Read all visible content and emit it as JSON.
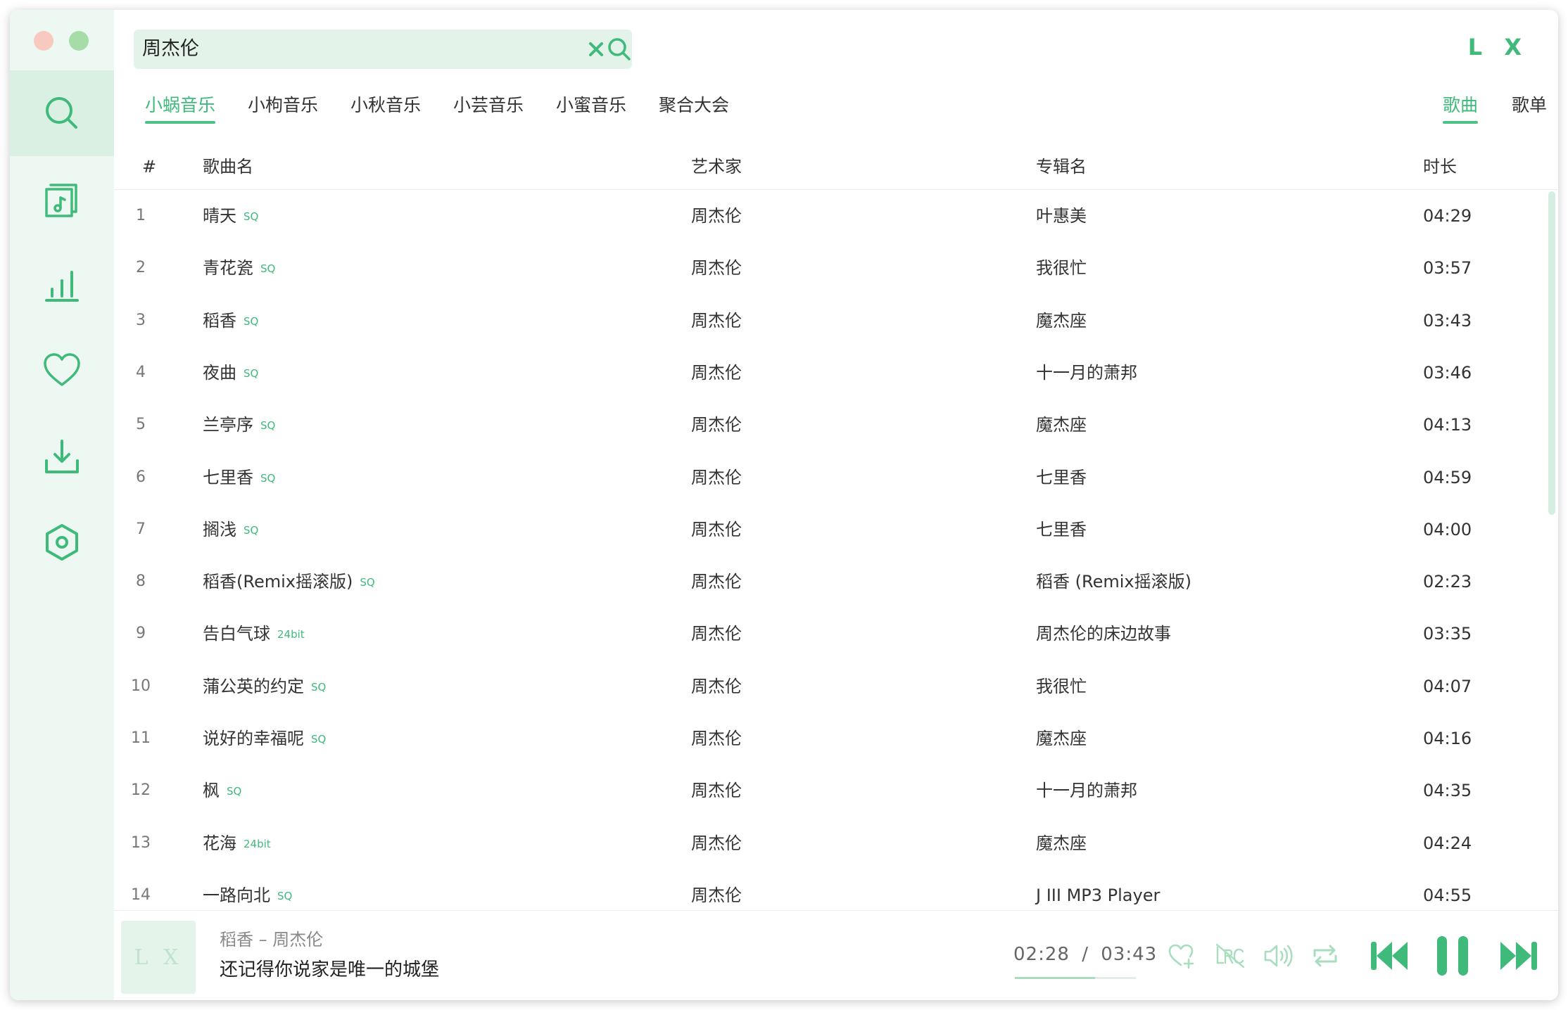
{
  "search": {
    "query": "周杰伦"
  },
  "brand": "L X",
  "source_tabs": [
    {
      "label": "小蜗音乐",
      "active": true
    },
    {
      "label": "小枸音乐",
      "active": false
    },
    {
      "label": "小秋音乐",
      "active": false
    },
    {
      "label": "小芸音乐",
      "active": false
    },
    {
      "label": "小蜜音乐",
      "active": false
    },
    {
      "label": "聚合大会",
      "active": false
    }
  ],
  "type_tabs": [
    {
      "label": "歌曲",
      "active": true
    },
    {
      "label": "歌单",
      "active": false
    }
  ],
  "columns": {
    "num": "#",
    "name": "歌曲名",
    "artist": "艺术家",
    "album": "专辑名",
    "duration": "时长"
  },
  "songs": [
    {
      "num": "1",
      "name": "晴天",
      "quality": "SQ",
      "artist": "周杰伦",
      "album": "叶惠美",
      "duration": "04:29"
    },
    {
      "num": "2",
      "name": "青花瓷",
      "quality": "SQ",
      "artist": "周杰伦",
      "album": "我很忙",
      "duration": "03:57"
    },
    {
      "num": "3",
      "name": "稻香",
      "quality": "SQ",
      "artist": "周杰伦",
      "album": "魔杰座",
      "duration": "03:43"
    },
    {
      "num": "4",
      "name": "夜曲",
      "quality": "SQ",
      "artist": "周杰伦",
      "album": "十一月的萧邦",
      "duration": "03:46"
    },
    {
      "num": "5",
      "name": "兰亭序",
      "quality": "SQ",
      "artist": "周杰伦",
      "album": "魔杰座",
      "duration": "04:13"
    },
    {
      "num": "6",
      "name": "七里香",
      "quality": "SQ",
      "artist": "周杰伦",
      "album": "七里香",
      "duration": "04:59"
    },
    {
      "num": "7",
      "name": "搁浅",
      "quality": "SQ",
      "artist": "周杰伦",
      "album": "七里香",
      "duration": "04:00"
    },
    {
      "num": "8",
      "name": "稻香(Remix摇滚版)",
      "quality": "SQ",
      "artist": "周杰伦",
      "album": "稻香 (Remix摇滚版)",
      "duration": "02:23"
    },
    {
      "num": "9",
      "name": "告白气球",
      "quality": "24bit",
      "artist": "周杰伦",
      "album": "周杰伦的床边故事",
      "duration": "03:35"
    },
    {
      "num": "10",
      "name": "蒲公英的约定",
      "quality": "SQ",
      "artist": "周杰伦",
      "album": "我很忙",
      "duration": "04:07"
    },
    {
      "num": "11",
      "name": "说好的幸福呢",
      "quality": "SQ",
      "artist": "周杰伦",
      "album": "魔杰座",
      "duration": "04:16"
    },
    {
      "num": "12",
      "name": "枫",
      "quality": "SQ",
      "artist": "周杰伦",
      "album": "十一月的萧邦",
      "duration": "04:35"
    },
    {
      "num": "13",
      "name": "花海",
      "quality": "24bit",
      "artist": "周杰伦",
      "album": "魔杰座",
      "duration": "04:24"
    },
    {
      "num": "14",
      "name": "一路向北",
      "quality": "SQ",
      "artist": "周杰伦",
      "album": "J III MP3 Player",
      "duration": "04:55"
    }
  ],
  "player": {
    "cover_text": "L X",
    "title": "稻香 – 周杰伦",
    "lyric": "还记得你说家是唯一的城堡",
    "current_time": "02:28",
    "separator": "/",
    "total_time": "03:43",
    "progress": 0.66
  },
  "colors": {
    "accent": "#3fba7b",
    "sidebar_bg": "#eef8f2",
    "search_bg": "#e3f3e9"
  },
  "sidebar_icons": [
    "search-icon",
    "music-list-icon",
    "chart-icon",
    "heart-icon",
    "download-icon",
    "settings-icon"
  ]
}
